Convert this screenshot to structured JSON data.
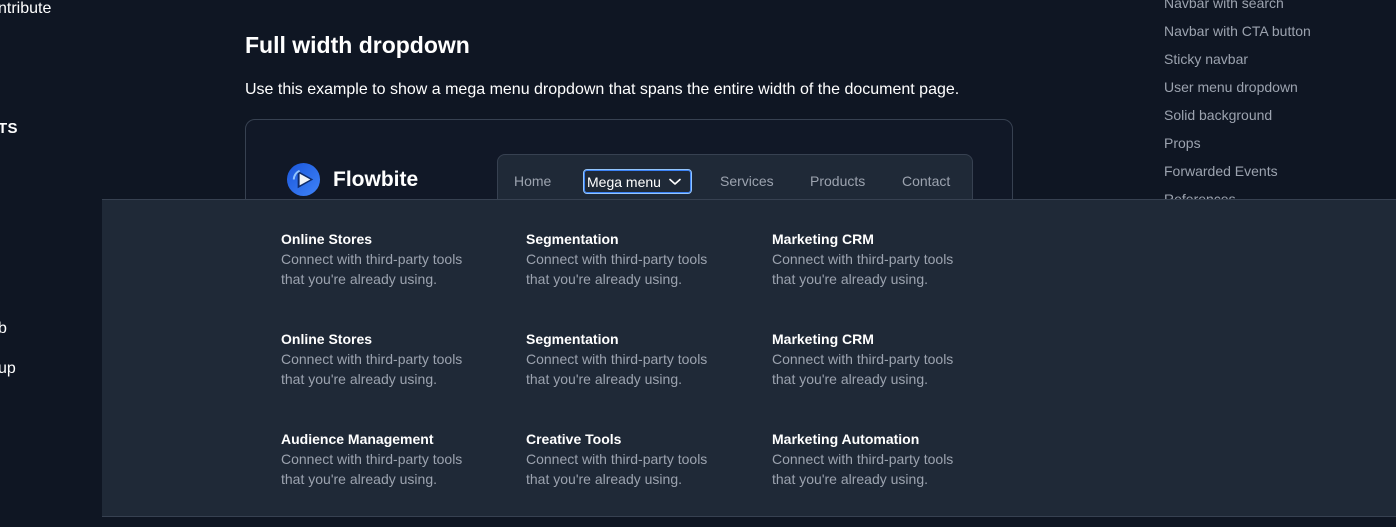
{
  "sidebar_left": {
    "frag_contribute": "ntribute",
    "frag_ts": "TS",
    "frag_b": "b",
    "frag_up": "up"
  },
  "toc": {
    "items": [
      "Navbar with search",
      "Navbar with CTA button",
      "Sticky navbar",
      "User menu dropdown",
      "Solid background",
      "Props",
      "Forwarded Events",
      "References"
    ]
  },
  "section": {
    "title": "Full width dropdown",
    "description": "Use this example to show a mega menu dropdown that spans the entire width of the document page."
  },
  "preview": {
    "brand_name": "Flowbite",
    "nav": {
      "home": "Home",
      "mega_menu": "Mega menu",
      "services": "Services",
      "products": "Products",
      "contact": "Contact"
    },
    "dropdown": [
      {
        "title": "Online Stores",
        "desc_line1": "Connect with third-party tools",
        "desc_line2": "that you're already using."
      },
      {
        "title": "Segmentation",
        "desc_line1": "Connect with third-party tools",
        "desc_line2": "that you're already using."
      },
      {
        "title": "Marketing CRM",
        "desc_line1": "Connect with third-party tools",
        "desc_line2": "that you're already using."
      },
      {
        "title": "Online Stores",
        "desc_line1": "Connect with third-party tools",
        "desc_line2": "that you're already using."
      },
      {
        "title": "Segmentation",
        "desc_line1": "Connect with third-party tools",
        "desc_line2": "that you're already using."
      },
      {
        "title": "Marketing CRM",
        "desc_line1": "Connect with third-party tools",
        "desc_line2": "that you're already using."
      },
      {
        "title": "Audience Management",
        "desc_line1": "Connect with third-party tools",
        "desc_line2": "that you're already using."
      },
      {
        "title": "Creative Tools",
        "desc_line1": "Connect with third-party tools",
        "desc_line2": "that you're already using."
      },
      {
        "title": "Marketing Automation",
        "desc_line1": "Connect with third-party tools",
        "desc_line2": "that you're already using."
      }
    ]
  },
  "colors": {
    "page_bg": "#0f1623",
    "panel_bg": "#1f2937",
    "muted_text": "#9ca3af",
    "focus_ring": "#3b82f6",
    "brand_blue": "#1c64f2"
  }
}
